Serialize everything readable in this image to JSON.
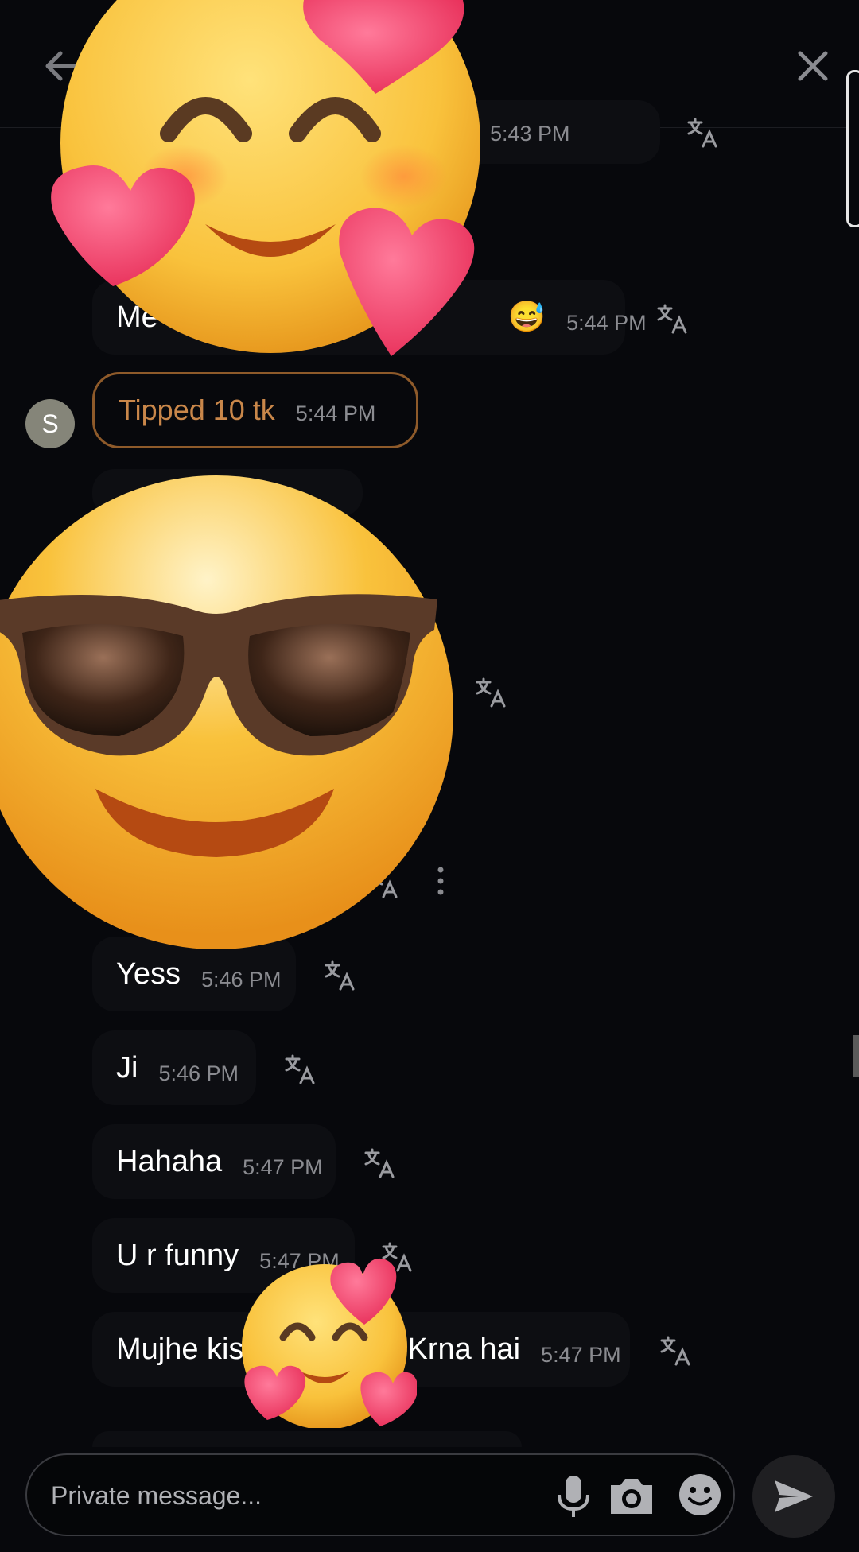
{
  "header": {
    "back_icon": "arrow-left-icon",
    "close_icon": "close-icon"
  },
  "messages": [
    {
      "text": "",
      "time": "5:43 PM"
    },
    {
      "text": "Me",
      "time": "5:44 PM",
      "inline_emoji": "😅"
    },
    {
      "text": "",
      "time": ""
    },
    {
      "text": "Yess",
      "time": "5:46 PM"
    },
    {
      "text": "Ji",
      "time": "5:46 PM"
    },
    {
      "text": "Hahaha",
      "time": "5:47 PM"
    },
    {
      "text": "U r funny",
      "time": "5:47 PM"
    },
    {
      "text_left": "Mujhe kis",
      "text_right": "Krna hai",
      "time": "5:47 PM"
    }
  ],
  "tip": {
    "text": "Tipped 10 tk",
    "time": "5:44 PM",
    "avatar_initial": "S"
  },
  "composer": {
    "placeholder": "Private message...",
    "mic_icon": "microphone-icon",
    "camera_icon": "camera-icon",
    "emoji_icon": "smiley-icon",
    "send_icon": "send-icon"
  },
  "colors": {
    "background": "#07080c",
    "bubble": "#0d0e12",
    "tip_accent": "#c9874a",
    "tip_border": "#8e5a2a"
  },
  "overlays": [
    "smiling-face-with-hearts-emoji",
    "sunglasses-face-emoji",
    "smiling-face-with-hearts-emoji-small"
  ]
}
